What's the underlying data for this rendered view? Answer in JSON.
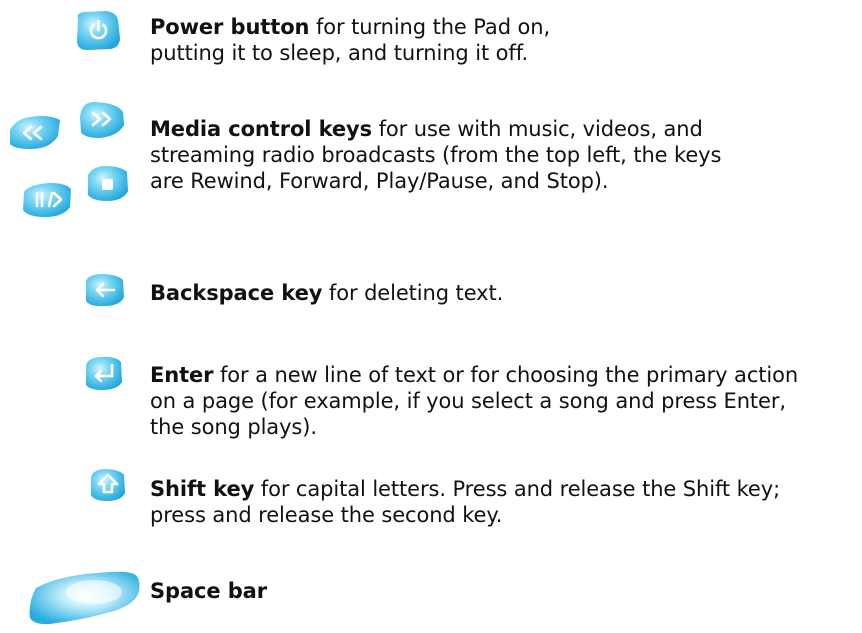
{
  "entries": [
    {
      "id": "power",
      "title": "Power button",
      "lines": [
        " for turning the Pad on,",
        "putting it to sleep, and turning it off."
      ],
      "icon": "power-icon"
    },
    {
      "id": "media",
      "title": "Media control keys",
      "lines": [
        " for use with music, videos, and",
        "streaming radio broadcasts (from the top left, the keys",
        "are Rewind, Forward, Play/Pause, and Stop)."
      ],
      "icon": "media-keys-icon"
    },
    {
      "id": "backspace",
      "title": "Backspace key",
      "lines": [
        " for deleting text."
      ],
      "icon": "left-arrow-icon"
    },
    {
      "id": "enter",
      "title": "Enter",
      "lines": [
        " for a new line of text or for choosing the primary action",
        "on a page (for example, if you select a song and press Enter,",
        "the song plays)."
      ],
      "icon": "enter-icon"
    },
    {
      "id": "shift",
      "title": "Shift key",
      "lines": [
        " for capital letters. Press and release the Shift key;",
        "press and release the second key."
      ],
      "icon": "shift-icon"
    },
    {
      "id": "space",
      "title": "Space bar",
      "lines": [],
      "icon": "space-bar-icon"
    }
  ],
  "colors": {
    "key_light": "#9fe3f7",
    "key_mid": "#3cc3ee",
    "key_dark": "#1aa3d9",
    "glyph": "#ffffff",
    "text": "#111111"
  }
}
